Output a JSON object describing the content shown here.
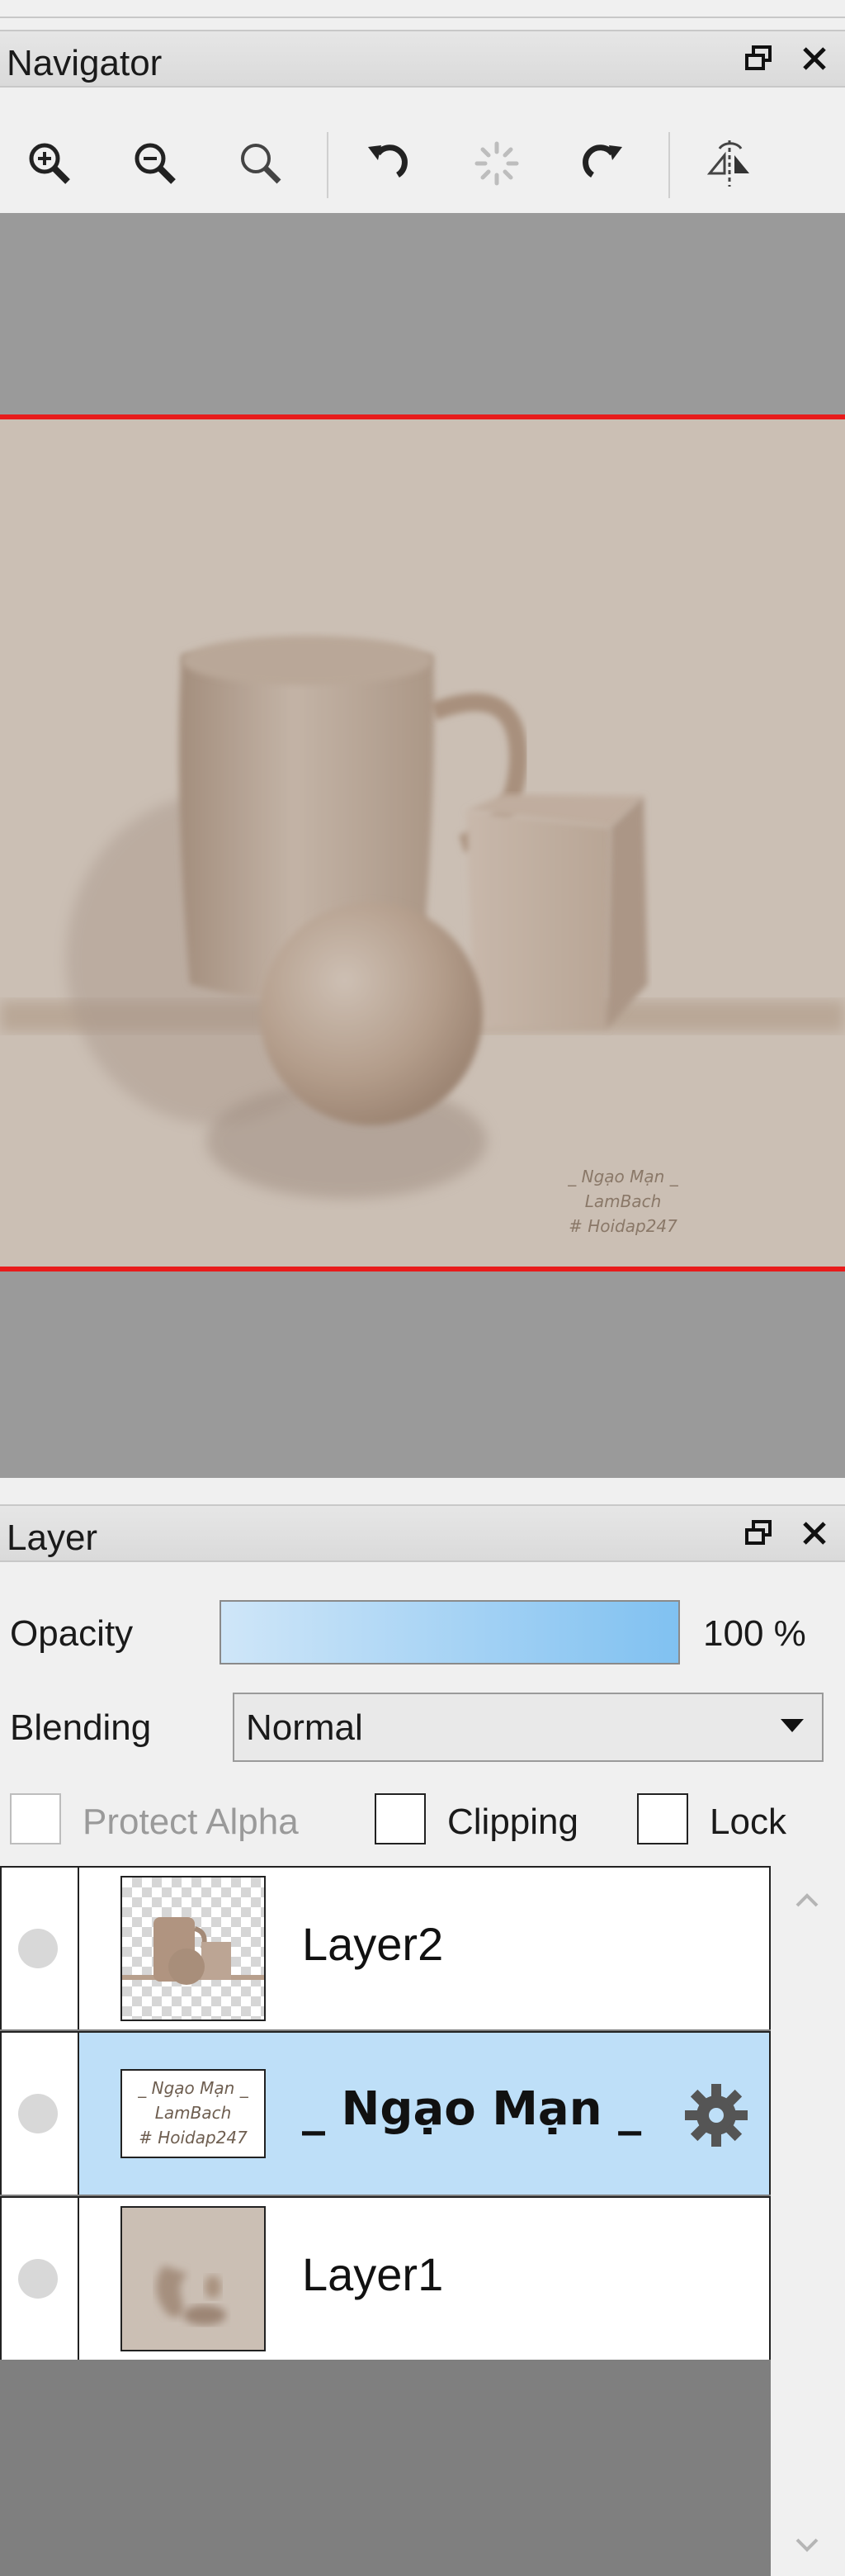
{
  "navigator": {
    "title": "Navigator",
    "tools": [
      "zoom-in-icon",
      "zoom-out-icon",
      "zoom-fit-icon",
      "rotate-left-icon",
      "reset-rotation-icon",
      "rotate-right-icon",
      "flip-horizontal-icon"
    ]
  },
  "canvas": {
    "signature": [
      "_ Ngạo Mạn _",
      "LamBach",
      "# Hoidap247"
    ]
  },
  "layer_panel": {
    "title": "Layer",
    "opacity_label": "Opacity",
    "opacity_value": "100 %",
    "opacity_fraction": 1.0,
    "blending_label": "Blending",
    "blending_value": "Normal",
    "protect_alpha_label": "Protect Alpha",
    "clipping_label": "Clipping",
    "lock_label": "Lock",
    "layers": [
      {
        "name": "Layer2",
        "selected": false
      },
      {
        "name": "_ Ngạo Mạn _",
        "selected": true
      },
      {
        "name": "Layer1",
        "selected": false
      }
    ]
  },
  "colors": {
    "accent": "#80c1f1",
    "selected_row": "#bedff8",
    "frame": "#e81b1b",
    "canvas": "#cbbfb4"
  }
}
